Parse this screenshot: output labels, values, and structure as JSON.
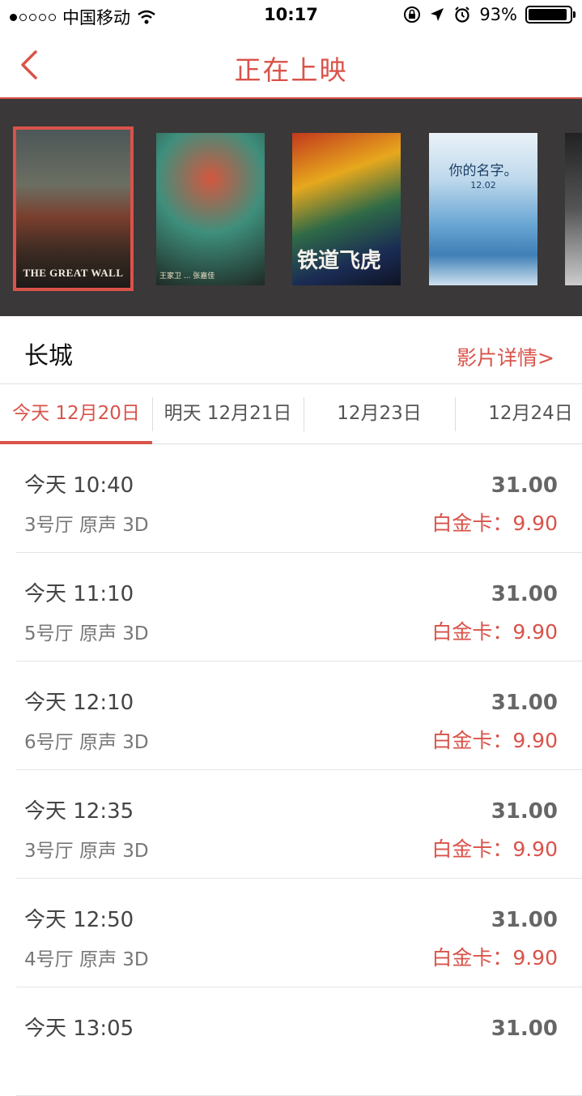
{
  "status_bar": {
    "carrier": "中国移动",
    "time": "10:17",
    "battery": "93%",
    "battery_level": 0.93
  },
  "nav": {
    "title": "正在上映"
  },
  "posters": [
    {
      "title": "THE GREAT WALL",
      "selected": true
    },
    {
      "caption": "王家卫 ... 张嘉佳",
      "selected": false
    },
    {
      "title": "铁道飞虎",
      "selected": false
    },
    {
      "title": "你的名字。",
      "date": "12.02",
      "selected": false
    },
    {
      "selected": false
    }
  ],
  "movie": {
    "title": "长城",
    "details_link": "影片详情>"
  },
  "date_tabs": [
    {
      "label": "今天 12月20日",
      "active": true
    },
    {
      "label": "明天 12月21日",
      "active": false
    },
    {
      "label": "12月23日",
      "active": false
    },
    {
      "label": "12月24日",
      "active": false
    }
  ],
  "showtimes": [
    {
      "time": "今天 10:40",
      "hall": "3号厅 原声 3D",
      "price": "31.00",
      "member_price": "白金卡：9.90"
    },
    {
      "time": "今天 11:10",
      "hall": "5号厅 原声 3D",
      "price": "31.00",
      "member_price": "白金卡：9.90"
    },
    {
      "time": "今天 12:10",
      "hall": "6号厅 原声 3D",
      "price": "31.00",
      "member_price": "白金卡：9.90"
    },
    {
      "time": "今天 12:35",
      "hall": "3号厅 原声 3D",
      "price": "31.00",
      "member_price": "白金卡：9.90"
    },
    {
      "time": "今天 12:50",
      "hall": "4号厅 原声 3D",
      "price": "31.00",
      "member_price": "白金卡：9.90"
    },
    {
      "time": "今天 13:05",
      "hall": "",
      "price": "31.00",
      "member_price": ""
    }
  ],
  "colors": {
    "accent": "#d9534a",
    "poster_strip_bg": "#3a3838"
  }
}
